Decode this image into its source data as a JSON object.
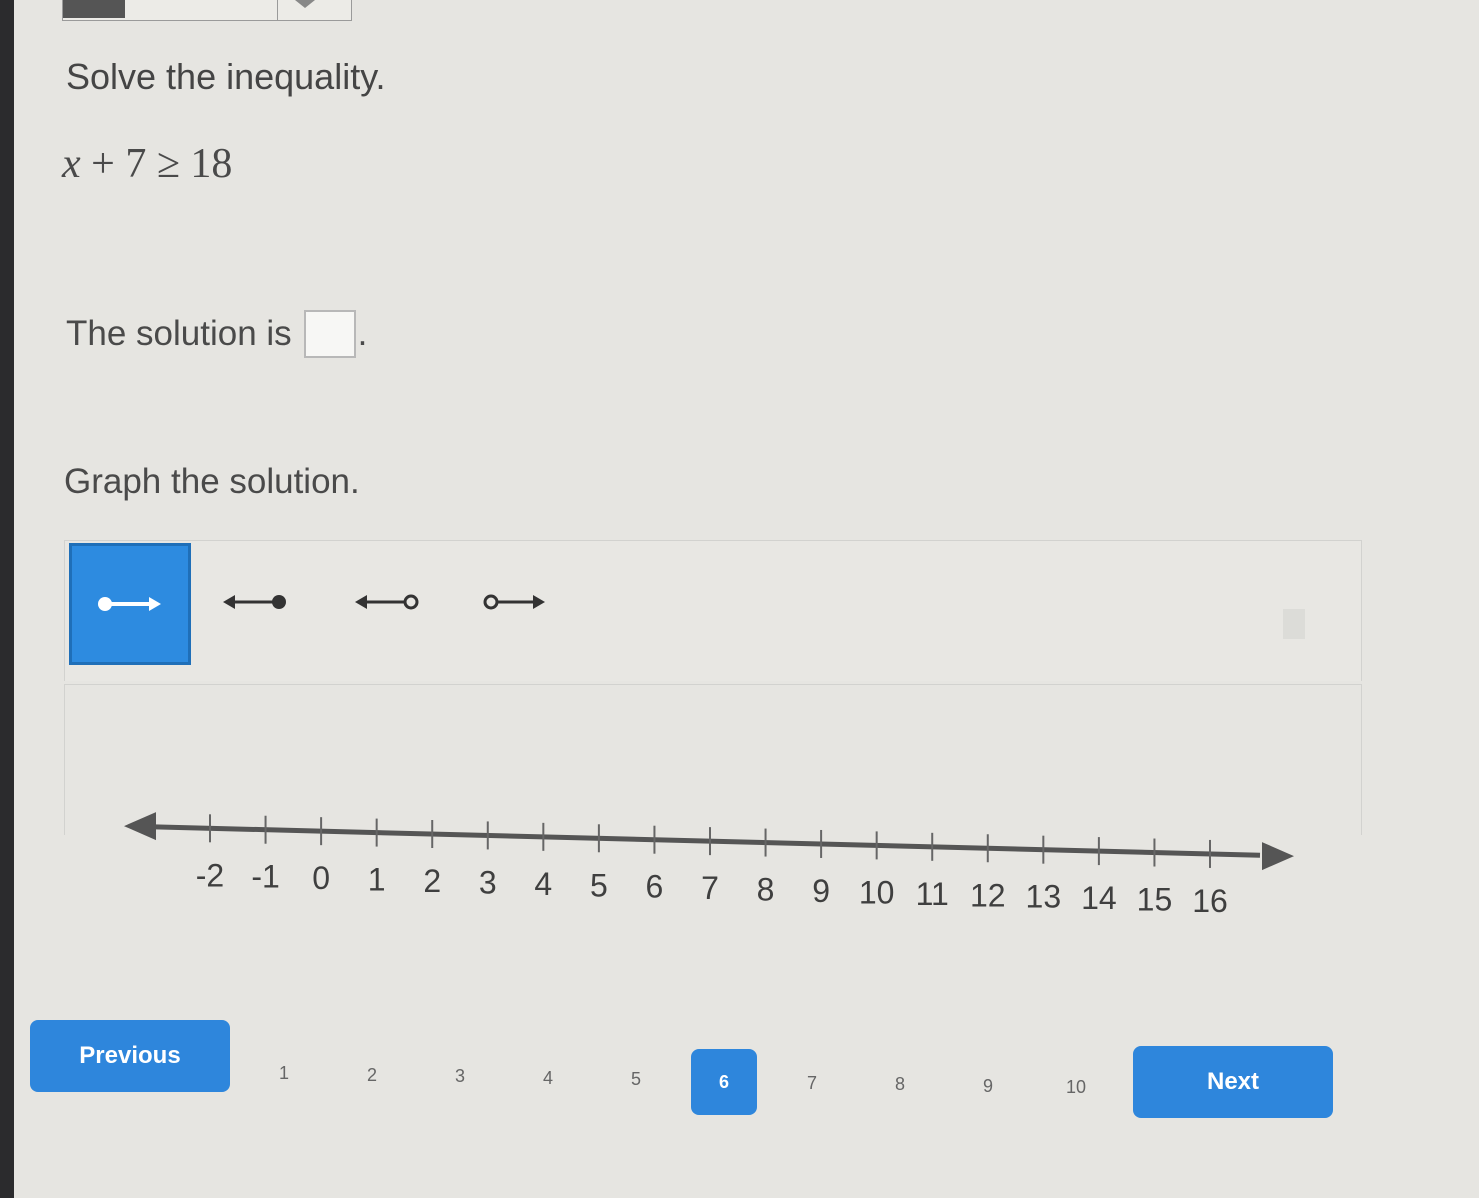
{
  "question": {
    "prompt": "Solve the inequality.",
    "equation": {
      "variable": "x",
      "rest": " + 7 ≥ 18"
    },
    "solution_label": "The solution is",
    "solution_value": "",
    "solution_period": ".",
    "graph_label": "Graph the solution."
  },
  "graph_tools": [
    {
      "name": "closed-ray-right-icon",
      "selected": true
    },
    {
      "name": "closed-ray-left-icon",
      "selected": false
    },
    {
      "name": "open-ray-left-icon",
      "selected": false
    },
    {
      "name": "open-ray-right-icon",
      "selected": false
    }
  ],
  "number_line": {
    "min": -2,
    "max": 16,
    "ticks": [
      "-2",
      "-1",
      "0",
      "1",
      "2",
      "3",
      "4",
      "5",
      "6",
      "7",
      "8",
      "9",
      "10",
      "11",
      "12",
      "13",
      "14",
      "15",
      "16"
    ]
  },
  "navigation": {
    "previous_label": "Previous",
    "next_label": "Next",
    "pages": [
      "1",
      "2",
      "3",
      "4",
      "5",
      "6",
      "7",
      "8",
      "9",
      "10"
    ],
    "current_page": "6"
  },
  "colors": {
    "accent": "#2e86dc",
    "tool_active": "#2d8be0",
    "text": "#4a4a4a",
    "line": "#555555"
  }
}
